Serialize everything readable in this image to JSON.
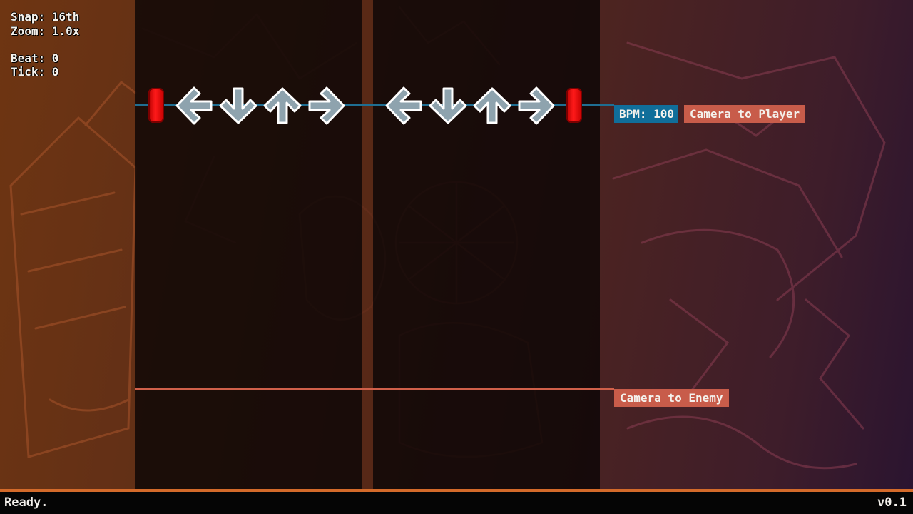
{
  "editor": {
    "snap": "Snap: 16th",
    "zoom": "Zoom: 1.0x",
    "beat": "Beat: 0",
    "tick": "Tick: 0"
  },
  "strumline": {
    "left_arrows": [
      "left-arrow-icon",
      "down-arrow-icon",
      "up-arrow-icon",
      "right-arrow-icon"
    ],
    "right_arrows": [
      "left-arrow-icon",
      "down-arrow-icon",
      "up-arrow-icon",
      "right-arrow-icon"
    ],
    "arrow_color": "#8ea3ae",
    "marker_color": "#ff1a1a"
  },
  "events": {
    "bpm": "BPM: 100",
    "camera_player": "Camera to Player",
    "camera_enemy": "Camera to Enemy"
  },
  "colors": {
    "bpm": "#106e9a",
    "camera": "#c85c4a",
    "status_border": "#d36a2a"
  },
  "statusbar": {
    "status": "Ready.",
    "version": "v0.1"
  }
}
